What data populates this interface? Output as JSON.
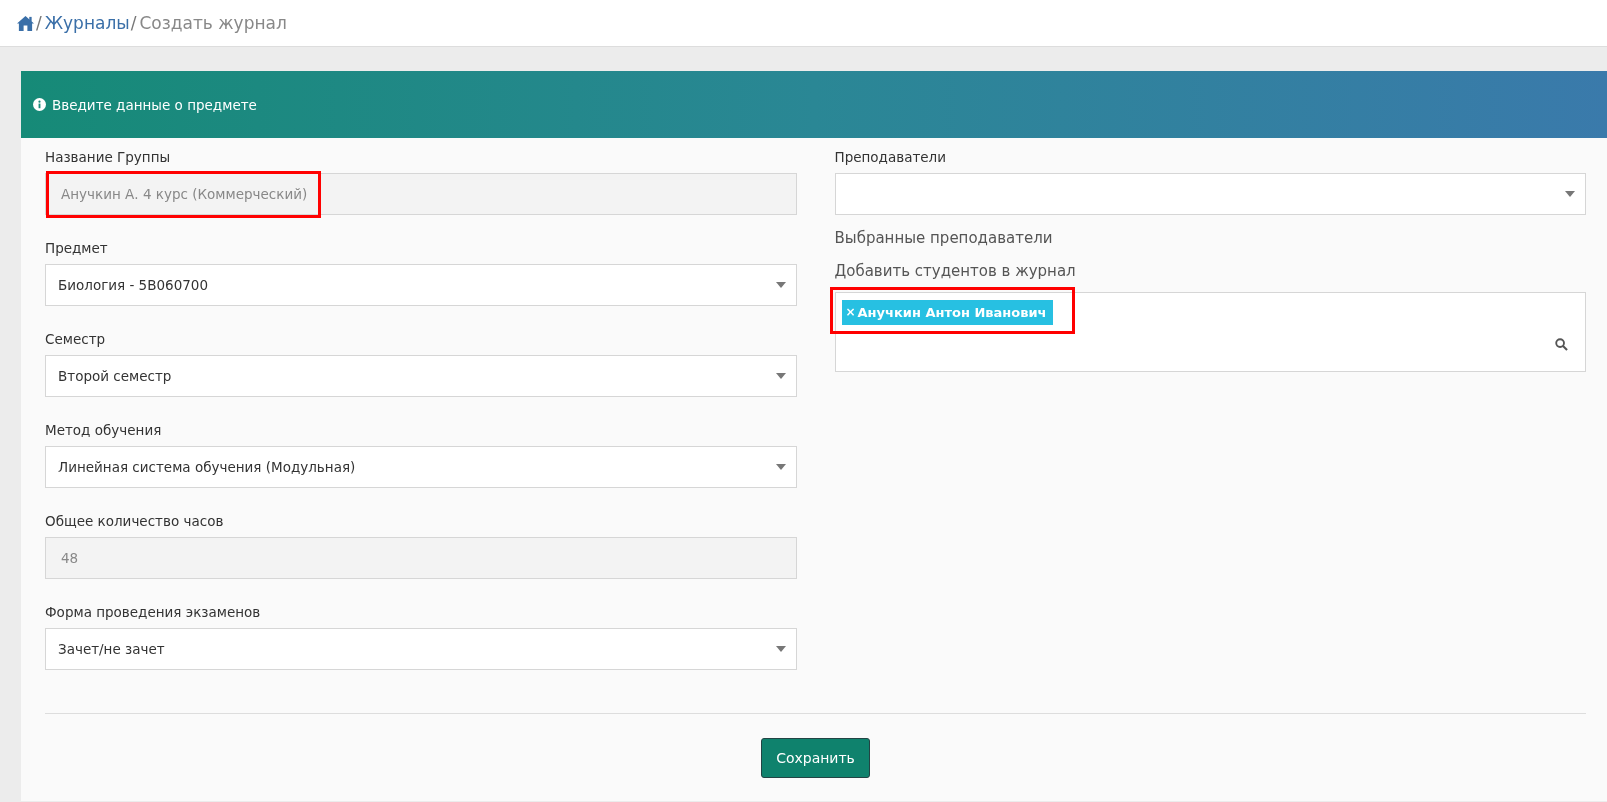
{
  "breadcrumb": {
    "separator": "/",
    "items": [
      {
        "label": "Журналы"
      },
      {
        "label": "Создать журнал"
      }
    ]
  },
  "panel": {
    "title": "Введите данные о предмете"
  },
  "left_fields": [
    {
      "label": "Название Группы",
      "kind": "text",
      "value": "Анучкин А. 4 курс (Коммерческий)",
      "disabled": true,
      "highlighted": true
    },
    {
      "label": "Предмет",
      "kind": "select",
      "value": "Биология - 5B060700",
      "disabled": false,
      "highlighted": false
    },
    {
      "label": "Семестр",
      "kind": "select",
      "value": "Второй семестр",
      "disabled": false,
      "highlighted": false
    },
    {
      "label": "Метод обучения",
      "kind": "select",
      "value": "Линейная система обучения (Модульная)",
      "disabled": false,
      "highlighted": false
    },
    {
      "label": "Общее количество часов",
      "kind": "text",
      "value": "48",
      "disabled": true,
      "highlighted": false
    },
    {
      "label": "Форма проведения экзаменов",
      "kind": "select",
      "value": "Зачет/не зачет",
      "disabled": false,
      "highlighted": false
    }
  ],
  "teachers": {
    "label": "Преподаватели",
    "selected_label": "Выбранные преподаватели"
  },
  "students": {
    "label": "Добавить студентов в журнал",
    "tags": [
      {
        "remove": "×",
        "name": "Анучкин Антон Иванович",
        "highlighted": true
      }
    ]
  },
  "save_button": "Сохранить"
}
